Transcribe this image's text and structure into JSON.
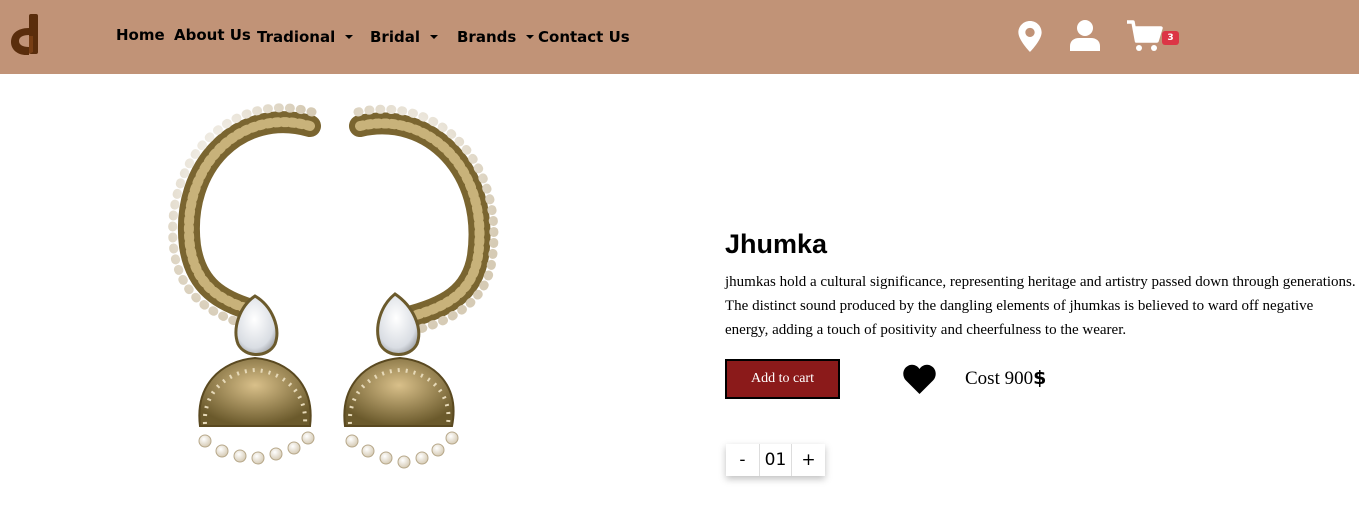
{
  "brand": {
    "logo_icon": "letter-d-logo-icon",
    "color": "#5a2d0c"
  },
  "nav": {
    "background": "#c19377",
    "items": [
      {
        "label": "Home",
        "dropdown": false
      },
      {
        "label": "About Us",
        "dropdown": false
      },
      {
        "label": "Tradional",
        "dropdown": true
      },
      {
        "label": "Bridal",
        "dropdown": true
      },
      {
        "label": "Brands",
        "dropdown": true
      },
      {
        "label": "Contact Us",
        "dropdown": false
      }
    ],
    "icons": [
      "location-pin-icon",
      "user-icon",
      "cart-icon"
    ],
    "cart_count": "3"
  },
  "product": {
    "image": "jhumka-earrings-image",
    "title": "Jhumka",
    "description": "jhumkas hold a cultural significance, representing heritage and artistry passed down through generations. The distinct sound produced by the dangling elements of jhumkas is believed to ward off negative energy, adding a touch of positivity and cheerfulness to the wearer.",
    "add_to_cart_label": "Add to cart",
    "add_to_cart_color": "#8b1a1a",
    "wishlist_icon": "heart-icon",
    "cost_label": "Cost 900",
    "cost_currency": "$",
    "quantity": {
      "minus_label": "-",
      "value": "01",
      "plus_label": "+"
    }
  }
}
